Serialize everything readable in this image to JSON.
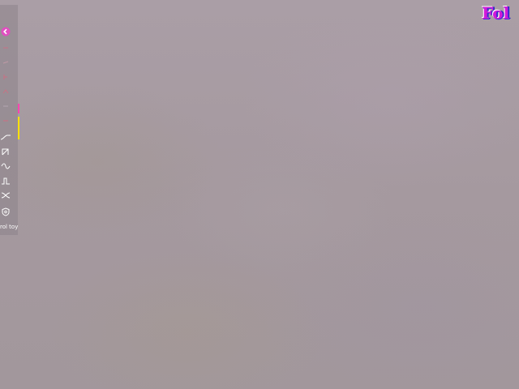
{
  "sidebar": {
    "label": "rol toy",
    "tools": [
      {
        "icon": "back-circle-icon"
      },
      {
        "icon": "faint-red-tool-icon"
      },
      {
        "icon": "faint-red-tool-icon"
      },
      {
        "icon": "faint-red-tool-icon"
      },
      {
        "icon": "faint-red-tool-icon"
      },
      {
        "icon": "faint-tool-icon"
      },
      {
        "icon": "faint-red-tool-icon"
      },
      {
        "icon": "ramp-curve-icon"
      },
      {
        "icon": "sawtooth-icon"
      },
      {
        "icon": "sine-wave-icon"
      },
      {
        "icon": "pulse-wave-icon"
      },
      {
        "icon": "crossing-waves-icon"
      },
      {
        "icon": "shield-icon"
      }
    ],
    "accent_colors": [
      "#ff44b0",
      "#ffe000"
    ]
  },
  "logo": {
    "text": "Fol"
  },
  "colors": {
    "background": "#a69aa1",
    "logo": "#d21ad8",
    "icon": "#ffffff",
    "faint_red": "#e8607a"
  }
}
